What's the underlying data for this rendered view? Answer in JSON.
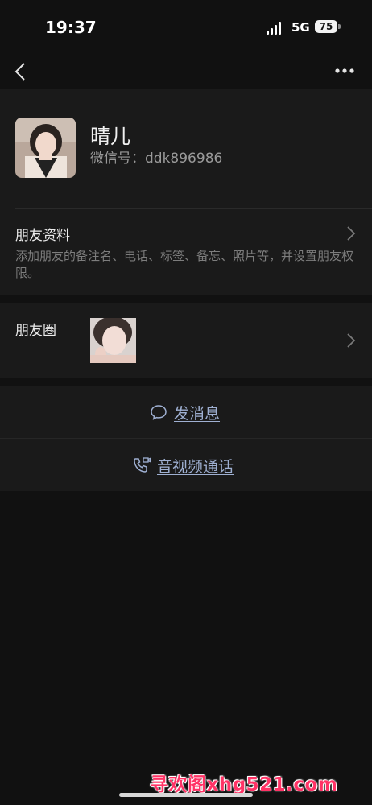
{
  "status_bar": {
    "time": "19:37",
    "network": "5G",
    "battery": "75"
  },
  "topbar": {
    "back_icon": "chevron-left-icon",
    "more_icon": "more-dots-icon"
  },
  "profile": {
    "name": "晴儿",
    "wechat_id": "微信号：ddk896986"
  },
  "friend_info": {
    "title": "朋友资料",
    "description": "添加朋友的备注名、电话、标签、备忘、照片等，并设置朋友权限。"
  },
  "moments": {
    "title": "朋友圈"
  },
  "actions": {
    "message": "发消息",
    "call": "音视频通话"
  },
  "watermark": "寻欢阁xhg521.com"
}
